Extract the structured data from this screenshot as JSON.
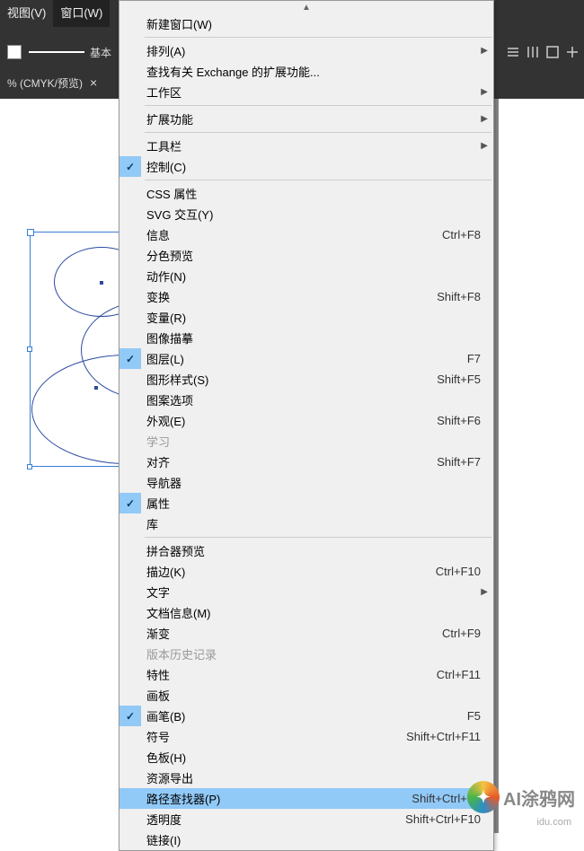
{
  "menubar": {
    "view": "视图(V)",
    "window": "窗口(W)"
  },
  "toolbar": {
    "basic": "基本"
  },
  "doc_tab": {
    "title": "% (CMYK/预览)",
    "close": "×"
  },
  "dropdown": {
    "scroll_up": "▲",
    "items": [
      {
        "label": "新建窗口(W)",
        "shortcut": "",
        "sub": false,
        "check": false,
        "disabled": false,
        "name": "menu-new-window"
      },
      {
        "sep": true
      },
      {
        "label": "排列(A)",
        "shortcut": "",
        "sub": true,
        "check": false,
        "disabled": false,
        "name": "menu-arrange"
      },
      {
        "label": "查找有关 Exchange 的扩展功能...",
        "shortcut": "",
        "sub": false,
        "check": false,
        "disabled": false,
        "name": "menu-exchange-ext"
      },
      {
        "label": "工作区",
        "shortcut": "",
        "sub": true,
        "check": false,
        "disabled": false,
        "name": "menu-workspace"
      },
      {
        "sep": true
      },
      {
        "label": "扩展功能",
        "shortcut": "",
        "sub": true,
        "check": false,
        "disabled": false,
        "name": "menu-extensions"
      },
      {
        "sep": true
      },
      {
        "label": "工具栏",
        "shortcut": "",
        "sub": true,
        "check": false,
        "disabled": false,
        "name": "menu-toolbars"
      },
      {
        "label": "控制(C)",
        "shortcut": "",
        "sub": false,
        "check": true,
        "disabled": false,
        "name": "menu-control"
      },
      {
        "sep": true
      },
      {
        "label": "CSS 属性",
        "shortcut": "",
        "sub": false,
        "check": false,
        "disabled": false,
        "name": "menu-css-props"
      },
      {
        "label": "SVG 交互(Y)",
        "shortcut": "",
        "sub": false,
        "check": false,
        "disabled": false,
        "name": "menu-svg-interactivity"
      },
      {
        "label": "信息",
        "shortcut": "Ctrl+F8",
        "sub": false,
        "check": false,
        "disabled": false,
        "name": "menu-info"
      },
      {
        "label": "分色预览",
        "shortcut": "",
        "sub": false,
        "check": false,
        "disabled": false,
        "name": "menu-separations"
      },
      {
        "label": "动作(N)",
        "shortcut": "",
        "sub": false,
        "check": false,
        "disabled": false,
        "name": "menu-actions"
      },
      {
        "label": "变换",
        "shortcut": "Shift+F8",
        "sub": false,
        "check": false,
        "disabled": false,
        "name": "menu-transform"
      },
      {
        "label": "变量(R)",
        "shortcut": "",
        "sub": false,
        "check": false,
        "disabled": false,
        "name": "menu-variables"
      },
      {
        "label": "图像描摹",
        "shortcut": "",
        "sub": false,
        "check": false,
        "disabled": false,
        "name": "menu-image-trace"
      },
      {
        "label": "图层(L)",
        "shortcut": "F7",
        "sub": false,
        "check": true,
        "disabled": false,
        "name": "menu-layers"
      },
      {
        "label": "图形样式(S)",
        "shortcut": "Shift+F5",
        "sub": false,
        "check": false,
        "disabled": false,
        "name": "menu-graphic-styles"
      },
      {
        "label": "图案选项",
        "shortcut": "",
        "sub": false,
        "check": false,
        "disabled": false,
        "name": "menu-pattern-options"
      },
      {
        "label": "外观(E)",
        "shortcut": "Shift+F6",
        "sub": false,
        "check": false,
        "disabled": false,
        "name": "menu-appearance"
      },
      {
        "label": "学习",
        "shortcut": "",
        "sub": false,
        "check": false,
        "disabled": true,
        "name": "menu-learn"
      },
      {
        "label": "对齐",
        "shortcut": "Shift+F7",
        "sub": false,
        "check": false,
        "disabled": false,
        "name": "menu-align"
      },
      {
        "label": "导航器",
        "shortcut": "",
        "sub": false,
        "check": false,
        "disabled": false,
        "name": "menu-navigator"
      },
      {
        "label": "属性",
        "shortcut": "",
        "sub": false,
        "check": true,
        "disabled": false,
        "name": "menu-properties"
      },
      {
        "label": "库",
        "shortcut": "",
        "sub": false,
        "check": false,
        "disabled": false,
        "name": "menu-libraries"
      },
      {
        "sep": true
      },
      {
        "label": "拼合器预览",
        "shortcut": "",
        "sub": false,
        "check": false,
        "disabled": false,
        "name": "menu-flattener"
      },
      {
        "label": "描边(K)",
        "shortcut": "Ctrl+F10",
        "sub": false,
        "check": false,
        "disabled": false,
        "name": "menu-stroke"
      },
      {
        "label": "文字",
        "shortcut": "",
        "sub": true,
        "check": false,
        "disabled": false,
        "name": "menu-type"
      },
      {
        "label": "文档信息(M)",
        "shortcut": "",
        "sub": false,
        "check": false,
        "disabled": false,
        "name": "menu-doc-info"
      },
      {
        "label": "渐变",
        "shortcut": "Ctrl+F9",
        "sub": false,
        "check": false,
        "disabled": false,
        "name": "menu-gradient"
      },
      {
        "label": "版本历史记录",
        "shortcut": "",
        "sub": false,
        "check": false,
        "disabled": true,
        "name": "menu-version-history"
      },
      {
        "label": "特性",
        "shortcut": "Ctrl+F11",
        "sub": false,
        "check": false,
        "disabled": false,
        "name": "menu-attributes"
      },
      {
        "label": "画板",
        "shortcut": "",
        "sub": false,
        "check": false,
        "disabled": false,
        "name": "menu-artboards"
      },
      {
        "label": "画笔(B)",
        "shortcut": "F5",
        "sub": false,
        "check": true,
        "disabled": false,
        "name": "menu-brushes"
      },
      {
        "label": "符号",
        "shortcut": "Shift+Ctrl+F11",
        "sub": false,
        "check": false,
        "disabled": false,
        "name": "menu-symbols"
      },
      {
        "label": "色板(H)",
        "shortcut": "",
        "sub": false,
        "check": false,
        "disabled": false,
        "name": "menu-swatches"
      },
      {
        "label": "资源导出",
        "shortcut": "",
        "sub": false,
        "check": false,
        "disabled": false,
        "name": "menu-asset-export"
      },
      {
        "label": "路径查找器(P)",
        "shortcut": "Shift+Ctrl+F9",
        "sub": false,
        "check": false,
        "disabled": false,
        "hl": true,
        "name": "menu-pathfinder"
      },
      {
        "label": "透明度",
        "shortcut": "Shift+Ctrl+F10",
        "sub": false,
        "check": false,
        "disabled": false,
        "name": "menu-transparency"
      },
      {
        "label": "链接(I)",
        "shortcut": "",
        "sub": false,
        "check": false,
        "disabled": false,
        "name": "menu-links"
      }
    ]
  },
  "watermark": {
    "text": "AI涂鸦网",
    "sub": "idu.com"
  }
}
